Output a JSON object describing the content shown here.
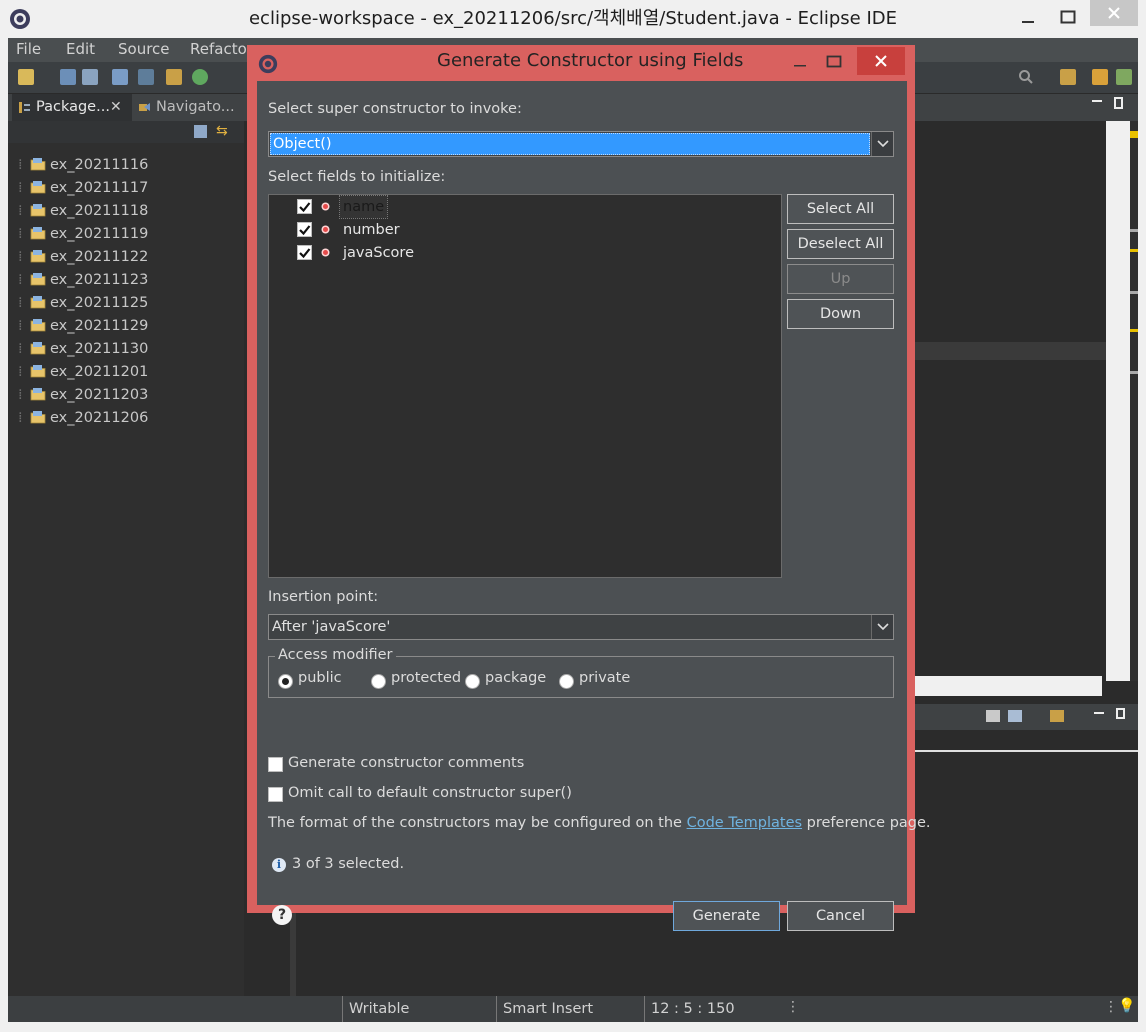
{
  "window": {
    "title": "eclipse-workspace - ex_20211206/src/객체배열/Student.java - Eclipse IDE"
  },
  "menu": [
    "File",
    "Edit",
    "Source",
    "Refactor"
  ],
  "explorer": {
    "tabs": [
      {
        "label": "Package..."
      },
      {
        "label": "Navigato..."
      }
    ],
    "projects": [
      "ex_20211116",
      "ex_20211117",
      "ex_20211118",
      "ex_20211119",
      "ex_20211122",
      "ex_20211123",
      "ex_20211125",
      "ex_20211129",
      "ex_20211130",
      "ex_20211201",
      "ex_20211203",
      "ex_20211206"
    ]
  },
  "status": {
    "writable": "Writable",
    "insert_mode": "Smart Insert",
    "position": "12 : 5 : 150"
  },
  "dialog": {
    "title": "Generate Constructor using Fields",
    "super_label": "Select super constructor to invoke:",
    "super_value": "Object()",
    "fields_label": "Select fields to initialize:",
    "fields": [
      {
        "name": "name",
        "checked": true
      },
      {
        "name": "number",
        "checked": true
      },
      {
        "name": "javaScore",
        "checked": true
      }
    ],
    "buttons": {
      "select_all": "Select All",
      "deselect_all": "Deselect All",
      "up": "Up",
      "down": "Down",
      "generate": "Generate",
      "cancel": "Cancel"
    },
    "insertion_label": "Insertion point:",
    "insertion_value": "After 'javaScore'",
    "access": {
      "legend": "Access modifier",
      "options": [
        "public",
        "protected",
        "package",
        "private"
      ],
      "selected": "public"
    },
    "gen_comments": "Generate constructor comments",
    "omit_super": "Omit call to default constructor super()",
    "format_pre": "The format of the constructors may be configured on the",
    "format_link": "Code Templates",
    "format_post": "preference page.",
    "selection_info": "3 of 3 selected."
  },
  "colors": {
    "dialog_border": "#d9615f",
    "selection": "#3399ff",
    "link": "#6fb3e0"
  }
}
